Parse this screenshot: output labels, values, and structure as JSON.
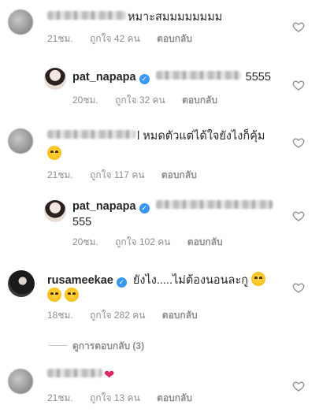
{
  "comments": [
    {
      "text": "หมาะสมมมมมมมม",
      "time": "21ชม.",
      "likes": "ถูกใจ 42 คน",
      "reply": "ตอบกลับ"
    },
    {
      "username": "pat_napapa",
      "text": "5555",
      "time": "20ชม.",
      "likes": "ถูกใจ 32 คน",
      "reply": "ตอบกลับ"
    },
    {
      "text": "l หมดตัวแต่ได้ใจยังไงก็คุ้ม",
      "time": "21ชม.",
      "likes": "ถูกใจ 117 คน",
      "reply": "ตอบกลับ"
    },
    {
      "username": "pat_napapa",
      "text": "555",
      "time": "20ชม.",
      "likes": "ถูกใจ 102 คน",
      "reply": "ตอบกลับ"
    },
    {
      "username": "rusameekae",
      "text": "ยังไง.....ไม่ต้องนอนละกู",
      "time": "18ชม.",
      "likes": "ถูกใจ 282 คน",
      "reply": "ตอบกลับ"
    },
    {
      "text": "",
      "time": "21ชม.",
      "likes": "ถูกใจ 13 คน",
      "reply": "ตอบกลับ"
    }
  ],
  "view_replies": "ดูการตอบกลับ (3)",
  "icons": {
    "like": "heart-outline-icon",
    "verified": "verified-badge-icon",
    "emoji": "grinning-face-emoji",
    "heart_emoji": "red-heart-emoji"
  },
  "colors": {
    "verified": "#3897f0",
    "muted": "#8e8e8e",
    "heart_emoji": "#e0245e"
  }
}
